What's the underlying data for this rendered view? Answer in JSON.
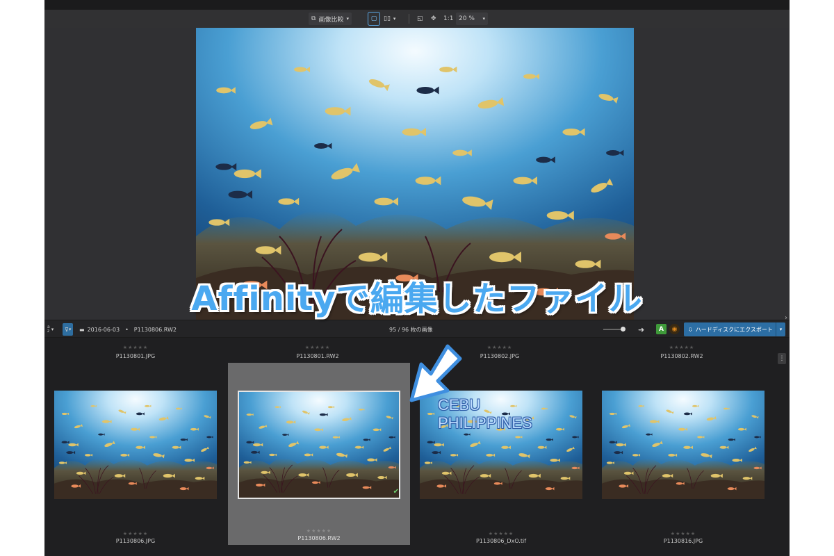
{
  "viewer_toolbar": {
    "compare_label": "画像比較",
    "zoom_fit_label": "1:1",
    "zoom_value": "20 %"
  },
  "browser_bar": {
    "sort_label": "a\nz",
    "breadcrumb_folder": "2016-06-03",
    "breadcrumb_file": "P1130806.RW2",
    "image_count": "95 / 96 枚の画像",
    "export_label": "ハードディスクにエクスポート"
  },
  "overlay": {
    "banner_text": "Affinityで編集したファイル",
    "watermark_line1": "CEBU",
    "watermark_line2": "PHILIPPINES"
  },
  "top_row": [
    {
      "stars": "★★★★★",
      "name": "P1130801.JPG"
    },
    {
      "stars": "★★★★★",
      "name": "P1130801.RW2"
    },
    {
      "stars": "★★★★★",
      "name": "P1130802.JPG"
    },
    {
      "stars": "★★★★★",
      "name": "P1130802.RW2"
    }
  ],
  "thumbs": [
    {
      "stars": "★★★★★",
      "name": "P1130806.JPG",
      "selected": false
    },
    {
      "stars": "★★★★★",
      "name": "P1130806.RW2",
      "selected": true
    },
    {
      "stars": "★★★★★",
      "name": "P1130806_DxO.tif",
      "selected": false
    },
    {
      "stars": "★★★★★",
      "name": "P1130816.JPG",
      "selected": false
    }
  ],
  "colors": {
    "accent": "#2c6ea4",
    "banner": "#4aa8f0",
    "background": "#2a2a2c"
  }
}
